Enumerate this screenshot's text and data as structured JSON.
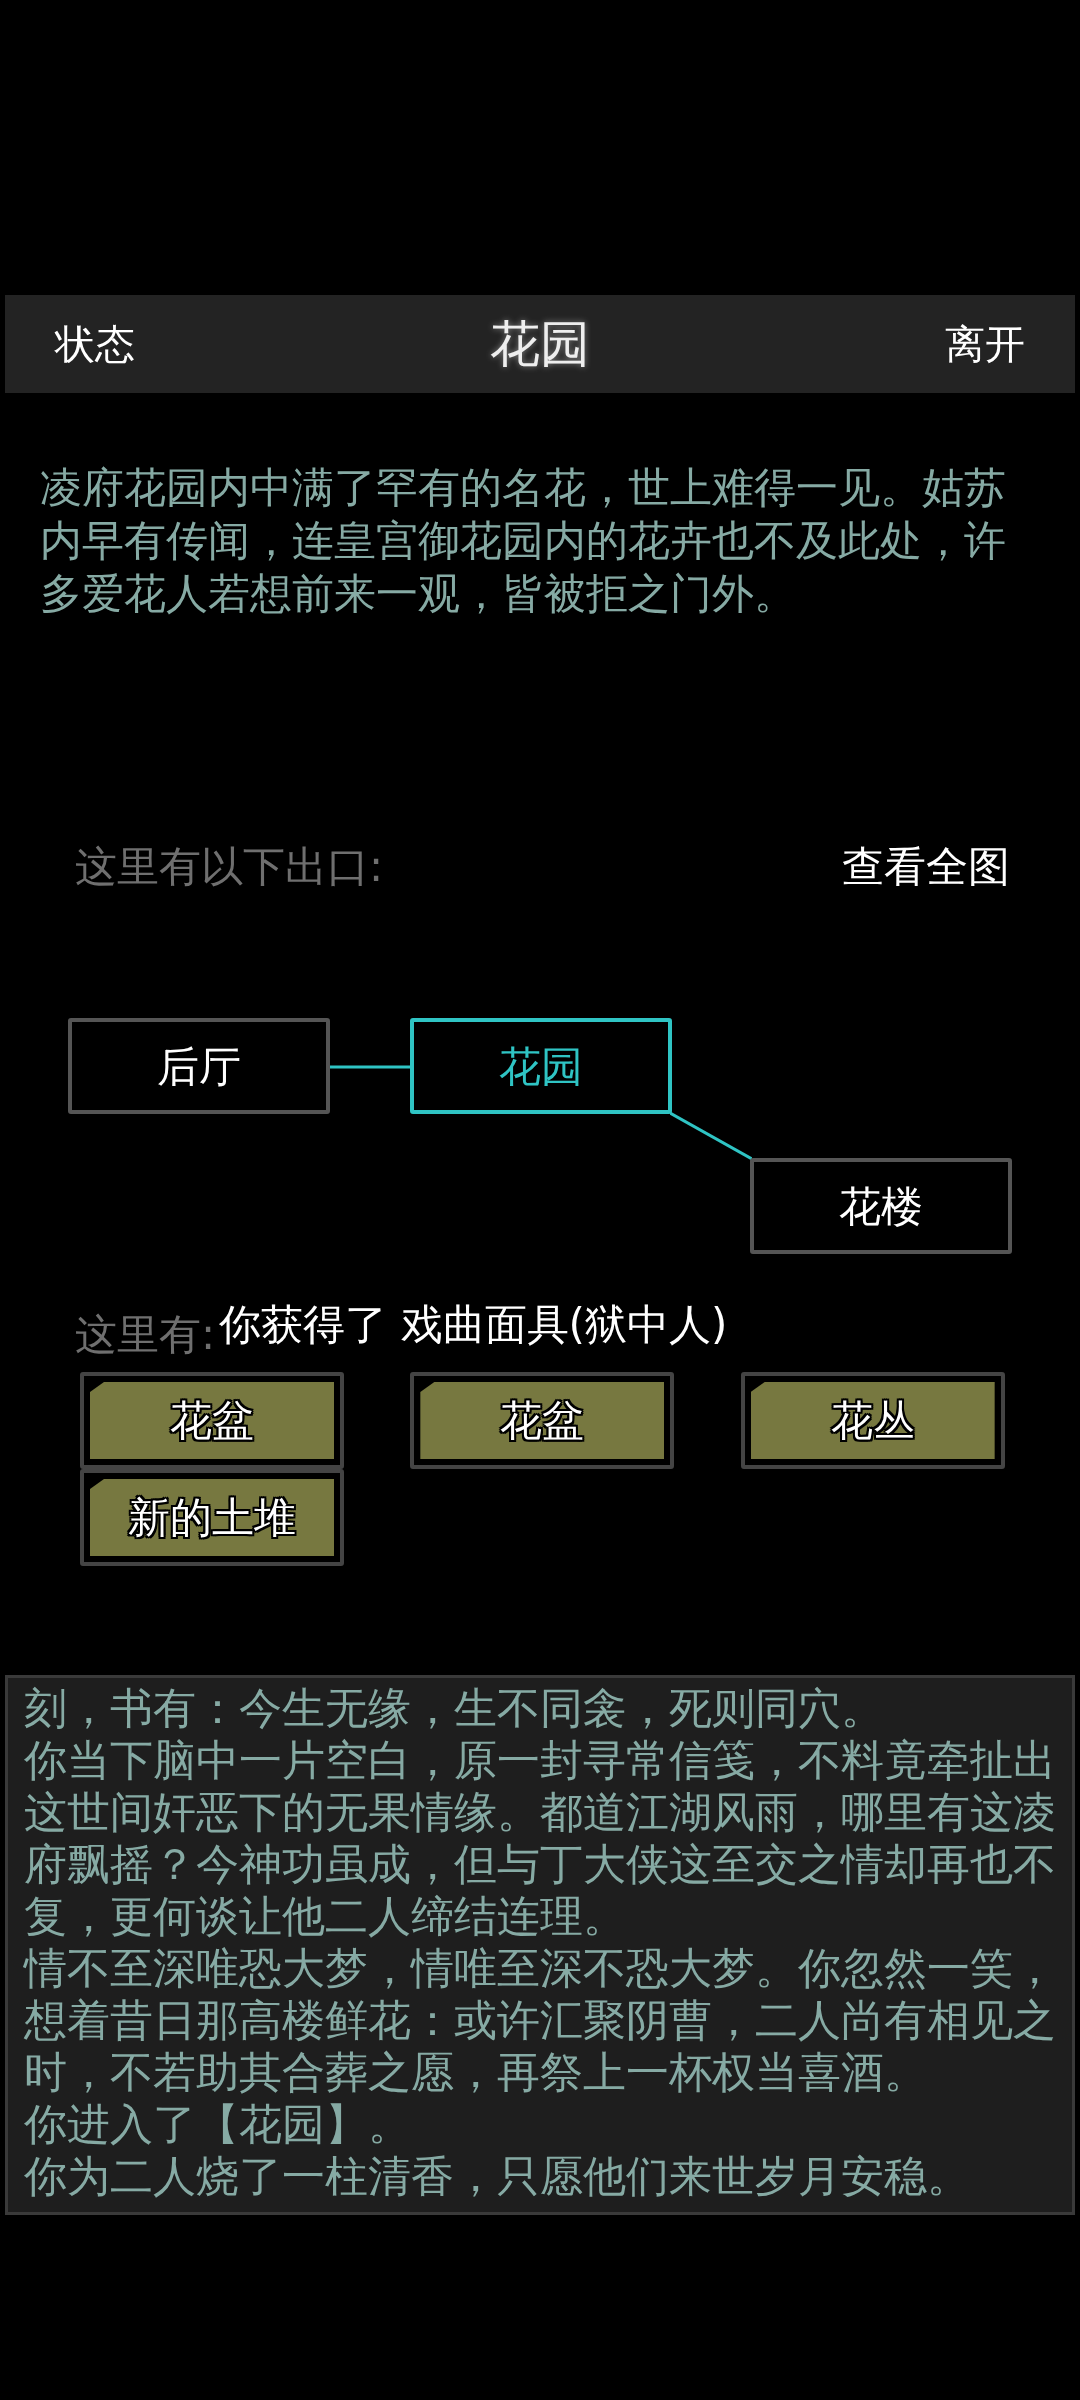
{
  "header": {
    "left": "状态",
    "title": "花园",
    "right": "离开"
  },
  "description": "凌府花园内中满了罕有的名花，世上难得一见。姑苏内早有传闻，连皇宫御花园内的花卉也不及此处，许多爱花人若想前来一观，皆被拒之门外。",
  "exits": {
    "label": "这里有以下出口:",
    "map_link": "查看全图",
    "nodes": [
      {
        "label": "后厅",
        "current": false
      },
      {
        "label": "花园",
        "current": true
      },
      {
        "label": "花楼",
        "current": false
      }
    ]
  },
  "objects": {
    "label": "这里有:",
    "notice": "你获得了 戏曲面具(狱中人)",
    "items": [
      "花盆",
      "花盆",
      "花丛",
      "新的土堆"
    ]
  },
  "log": [
    "刻，书有：今生无缘，生不同衾，死则同穴。",
    "你当下脑中一片空白，原一封寻常信笺，不料竟牵扯出这世间奸恶下的无果情缘。都道江湖风雨，哪里有这凌府飘摇？今神功虽成，但与丁大侠这至交之情却再也不复，更何谈让他二人缔结连理。",
    "情不至深唯恐大梦，情唯至深不恐大梦。你忽然一笑，想着昔日那高楼鲜花：或许汇聚阴曹，二人尚有相见之时，不若助其合葬之愿，再祭上一杯权当喜酒。",
    "你进入了【花园】。",
    "你为二人烧了一柱清香，只愿他们来世岁月安稳。"
  ]
}
